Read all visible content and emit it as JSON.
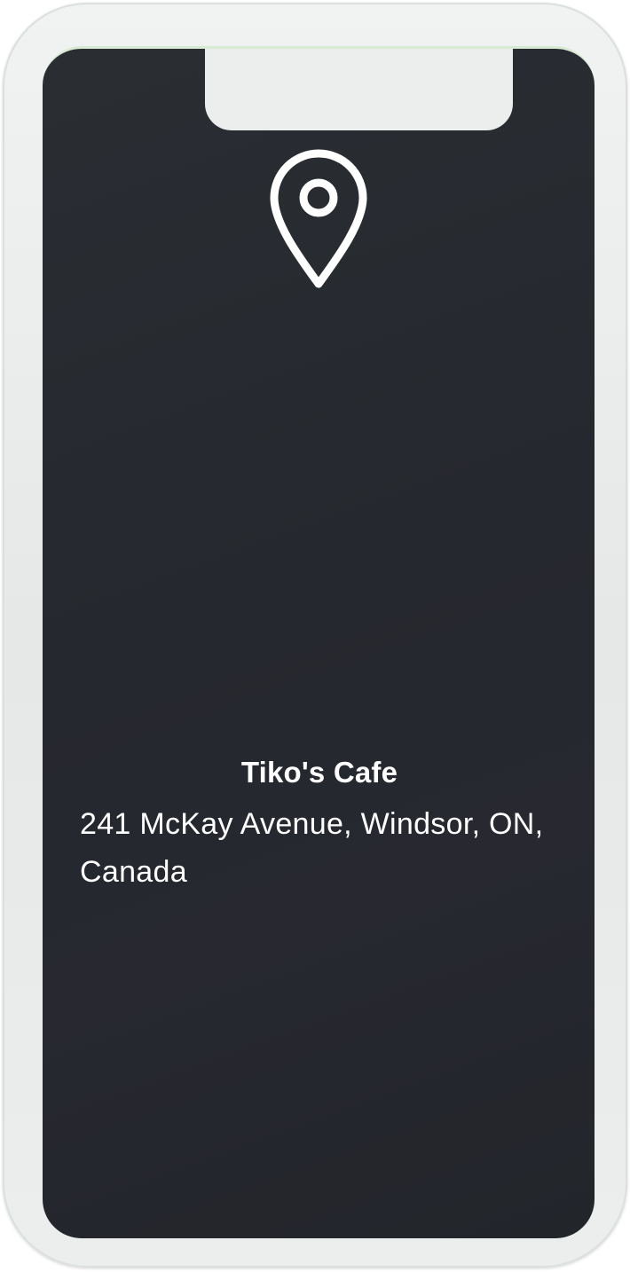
{
  "location": {
    "icon": "map-pin-icon",
    "name": "Tiko's Cafe",
    "address": "241 McKay Avenue, Windsor, ON, Canada"
  },
  "colors": {
    "screen_background": "#25282e",
    "text": "#ffffff",
    "device_frame": "#eceded"
  }
}
